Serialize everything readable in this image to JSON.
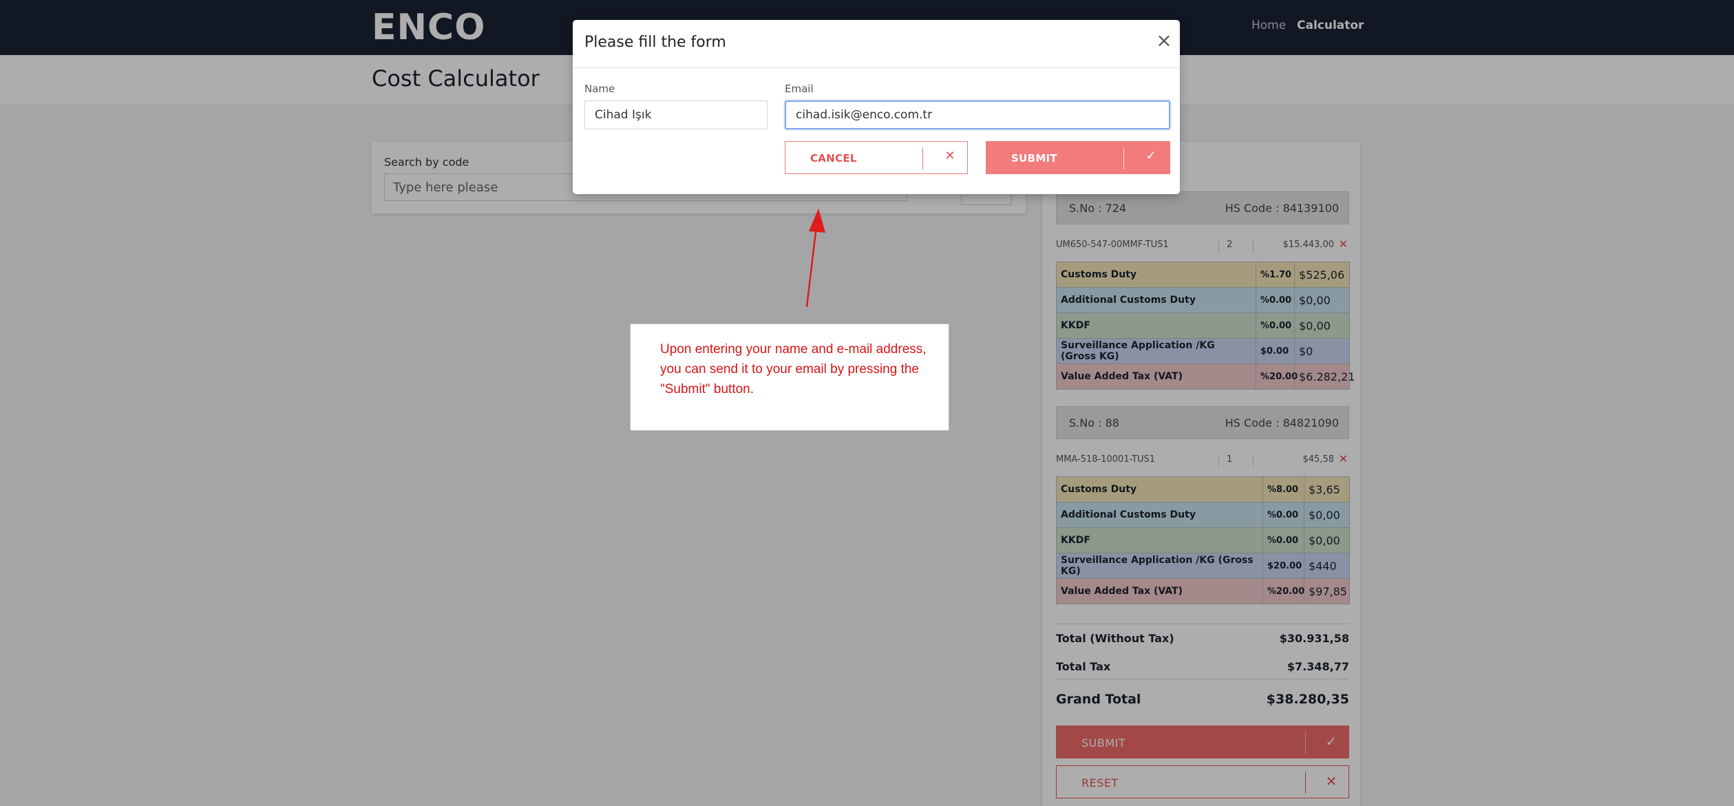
{
  "navbar": {
    "logo": "ENCO",
    "links": [
      "Home",
      "Calculator"
    ]
  },
  "page": {
    "title": "Cost Calculator"
  },
  "search": {
    "label": "Search by code",
    "placeholder": "Type here please"
  },
  "summary": {
    "items": [
      {
        "sno": "S.No : 724",
        "hs": "HS Code : 84139100",
        "code": "UM650-547-00MMF-TUS1",
        "qty": "2",
        "price": "$15.443,00",
        "taxes": [
          {
            "name": "Customs Duty",
            "rate": "%1.70",
            "amount": "$525,06",
            "color": "#f5e6b8"
          },
          {
            "name": "Additional Customs Duty",
            "rate": "%0.00",
            "amount": "$0,00",
            "color": "#c9e4ef"
          },
          {
            "name": "KKDF",
            "rate": "%0.00",
            "amount": "$0,00",
            "color": "#cde4cd"
          },
          {
            "name": "Surveillance Application /KG (Gross KG)",
            "rate": "$0.00",
            "amount": "$0",
            "color": "#cdd6f2"
          },
          {
            "name": "Value Added Tax (VAT)",
            "rate": "%20.00",
            "amount": "$6.282,21",
            "color": "#f0cbcb"
          }
        ]
      },
      {
        "sno": "S.No : 88",
        "hs": "HS Code : 84821090",
        "code": "MMA-518-10001-TUS1",
        "qty": "1",
        "price": "$45,58",
        "taxes": [
          {
            "name": "Customs Duty",
            "rate": "%8.00",
            "amount": "$3,65",
            "color": "#f5e6b8"
          },
          {
            "name": "Additional Customs Duty",
            "rate": "%0.00",
            "amount": "$0,00",
            "color": "#c9e4ef"
          },
          {
            "name": "KKDF",
            "rate": "%0.00",
            "amount": "$0,00",
            "color": "#cde4cd"
          },
          {
            "name": "Surveillance Application /KG (Gross KG)",
            "rate": "$20.00",
            "amount": "$440",
            "color": "#cdd6f2"
          },
          {
            "name": "Value Added Tax (VAT)",
            "rate": "%20.00",
            "amount": "$97,85",
            "color": "#f0cbcb"
          }
        ]
      }
    ],
    "total_without_tax_label": "Total (Without Tax)",
    "total_without_tax": "$30.931,58",
    "total_tax_label": "Total Tax",
    "total_tax": "$7.348,77",
    "grand_total_label": "Grand Total",
    "grand_total": "$38.280,35",
    "submit_label": "SUBMIT",
    "reset_label": "RESET"
  },
  "modal": {
    "title": "Please fill the form",
    "name_label": "Name",
    "name_value": "Cihad Işık",
    "email_label": "Email",
    "email_value": "cihad.isik@enco.com.tr",
    "cancel_label": "CANCEL",
    "submit_label": "SUBMIT"
  },
  "annotation": {
    "text": "Upon entering your name and e-mail address, you can send it to your email by pressing the \"Submit\" button."
  },
  "colors": {
    "navbar": "#1b2236",
    "accent": "#f27b7b",
    "annotation_text": "#d81515"
  }
}
